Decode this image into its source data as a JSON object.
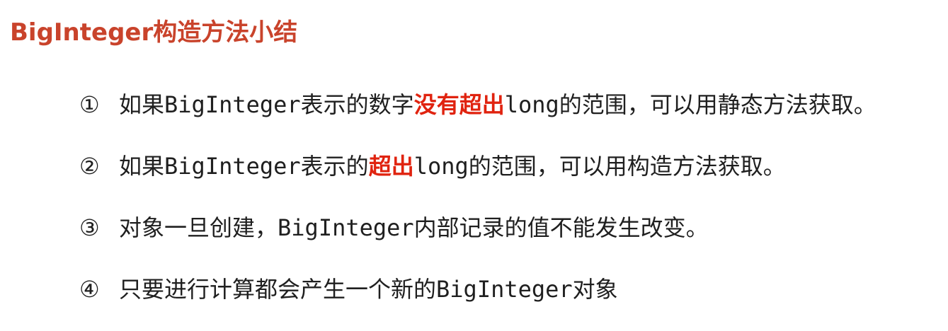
{
  "title": "BigInteger构造方法小结",
  "items": [
    {
      "num": "①",
      "pre": "如果",
      "code1": "BigInteger",
      "mid": "表示的数字",
      "highlight": "没有超出",
      "code2": "long",
      "post": "的范围，可以用静态方法获取。"
    },
    {
      "num": "②",
      "pre": "如果",
      "code1": "BigInteger",
      "mid": "表示的",
      "highlight": "超出",
      "code2": "long",
      "post": "的范围，可以用构造方法获取。"
    },
    {
      "num": "③",
      "pre": "对象一旦创建，",
      "code1": "BigInteger",
      "post": "内部记录的值不能发生改变。"
    },
    {
      "num": "④",
      "pre": "只要进行计算都会产生一个新的",
      "code1": "BigInteger",
      "post": "对象"
    }
  ],
  "colors": {
    "title": "#c9432b",
    "highlight": "#e0230f",
    "text": "#1f1f1f"
  }
}
